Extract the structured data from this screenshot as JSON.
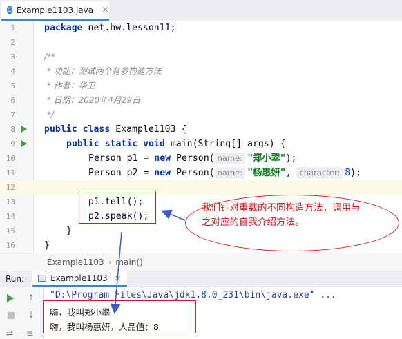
{
  "tab": {
    "icon": "java-class-icon",
    "icon_glyph": "C",
    "label": "Example1103.java",
    "close": "×"
  },
  "code_lines": [
    {
      "num": "1"
    },
    {
      "num": "2"
    },
    {
      "num": "3"
    },
    {
      "num": "4"
    },
    {
      "num": "5"
    },
    {
      "num": "6"
    },
    {
      "num": "7"
    },
    {
      "num": "8"
    },
    {
      "num": "9"
    },
    {
      "num": "10"
    },
    {
      "num": "11"
    },
    {
      "num": "12"
    },
    {
      "num": "13"
    },
    {
      "num": "14"
    },
    {
      "num": "15"
    },
    {
      "num": "16"
    }
  ],
  "code": {
    "l1_kw": "package",
    "l1_rest": " net.hw.lesson11;",
    "l4": "/**",
    "l5": " * 功能：测试两个有参构造方法",
    "l6": " * 作者：华卫",
    "l7": " * 日期：2020年4月29日",
    "l8": " */",
    "l9_kw": "public class",
    "l9_rest": " Example1103 {",
    "l10_kw": "public static void",
    "l10_rest": " main(String[] args) {",
    "l11_a": "Person p1 = ",
    "l11_kw": "new",
    "l11_b": " Person(",
    "l11_hint": "name:",
    "l11_str": "\"郑小翠\"",
    "l11_c": ");",
    "l12_a": "Person p2 = ",
    "l12_kw": "new",
    "l12_b": " Person(",
    "l12_hint1": "name:",
    "l12_str": "\"杨惠妍\"",
    "l12_c": ", ",
    "l12_hint2": "character:",
    "l12_num": "8",
    "l12_d": ");",
    "l14": "p1.tell();",
    "l15": "p2.speak();",
    "l16": "}",
    "l17": "}"
  },
  "breadcrumb": {
    "class": "Example1103",
    "sep": "›",
    "method": "main()"
  },
  "run_panel": {
    "title": "Run:",
    "tab_label": "Example1103",
    "tab_close": "×"
  },
  "console": {
    "cmd": "\"D:\\Program Files\\Java\\jdk1.8.0_231\\bin\\java.exe\" ...",
    "out1": "嗨，我叫郑小翠",
    "out2": "嗨，我叫杨惠妍，人品值：8"
  },
  "annotation": {
    "text": "我们针对重载的不同构造方法，调用与之对应的自我介绍方法。"
  },
  "colors": {
    "accent": "#4083c9",
    "annotation": "#d92020",
    "run_green": "#3da33d"
  }
}
